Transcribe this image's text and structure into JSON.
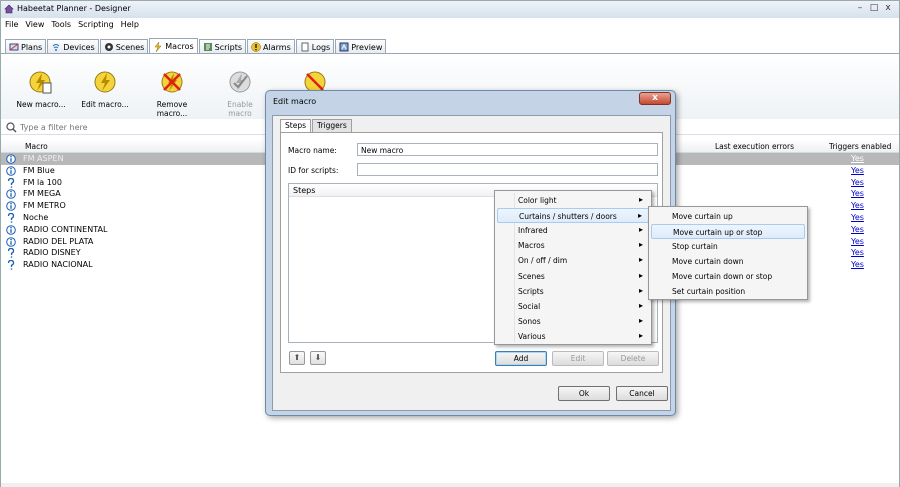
{
  "window": {
    "title": "Habeetat Planner - Designer",
    "controls": [
      "–",
      "□",
      "x"
    ]
  },
  "menubar": [
    "File",
    "View",
    "Tools",
    "Scripting",
    "Help"
  ],
  "tabs": [
    {
      "label": "Plans",
      "icon": "plans-icon"
    },
    {
      "label": "Devices",
      "icon": "devices-icon"
    },
    {
      "label": "Scenes",
      "icon": "scenes-icon"
    },
    {
      "label": "Macros",
      "icon": "macros-icon",
      "active": true
    },
    {
      "label": "Scripts",
      "icon": "scripts-icon"
    },
    {
      "label": "Alarms",
      "icon": "alarms-icon"
    },
    {
      "label": "Logs",
      "icon": "logs-icon"
    },
    {
      "label": "Preview",
      "icon": "preview-icon"
    }
  ],
  "toolbar": {
    "new": "New macro...",
    "edit": "Edit macro...",
    "remove": "Remove macro...",
    "enable": "Enable macro"
  },
  "filter": {
    "placeholder": "Type a filter here"
  },
  "grid": {
    "columns": {
      "macro": "Macro",
      "errors": "Last execution errors",
      "triggers": "Triggers enabled"
    },
    "rows": [
      {
        "name": "FM ASPEN",
        "triggers": "Yes",
        "icon": "info-icon",
        "selected": true
      },
      {
        "name": "FM Blue",
        "triggers": "Yes",
        "icon": "info-icon"
      },
      {
        "name": "FM la 100",
        "triggers": "Yes",
        "icon": "question-icon"
      },
      {
        "name": "FM MEGA",
        "triggers": "Yes",
        "icon": "info-icon"
      },
      {
        "name": "FM METRO",
        "triggers": "Yes",
        "icon": "info-icon"
      },
      {
        "name": "Noche",
        "triggers": "Yes",
        "icon": "question-icon"
      },
      {
        "name": "RADIO CONTINENTAL",
        "triggers": "Yes",
        "icon": "info-icon"
      },
      {
        "name": "RADIO DEL PLATA",
        "triggers": "Yes",
        "icon": "info-icon"
      },
      {
        "name": "RADIO DISNEY",
        "triggers": "Yes",
        "icon": "question-icon"
      },
      {
        "name": "RADIO NACIONAL",
        "triggers": "Yes",
        "icon": "question-icon"
      }
    ]
  },
  "dialog": {
    "title": "Edit macro",
    "close": "x",
    "tabs": [
      "Steps",
      "Triggers"
    ],
    "macro_name_label": "Macro name:",
    "macro_name_value": "New macro",
    "id_label": "ID for scripts:",
    "id_value": "",
    "steps_header": "Steps",
    "add": "Add",
    "edit": "Edit",
    "delete": "Delete",
    "ok": "Ok",
    "cancel": "Cancel",
    "up": "⬆",
    "down": "⬇"
  },
  "context_menu": [
    {
      "label": "Color light",
      "arrow": "▸"
    },
    {
      "label": "Curtains / shutters / doors",
      "arrow": "▸",
      "highlighted": true
    },
    {
      "label": "Infrared",
      "arrow": "▸"
    },
    {
      "label": "Macros",
      "arrow": "▸"
    },
    {
      "label": "On / off / dim",
      "arrow": "▸"
    },
    {
      "label": "Scenes",
      "arrow": "▸"
    },
    {
      "label": "Scripts",
      "arrow": "▸"
    },
    {
      "label": "Social",
      "arrow": "▸"
    },
    {
      "label": "Sonos",
      "arrow": "▸"
    },
    {
      "label": "Various",
      "arrow": "▸"
    }
  ],
  "submenu": [
    {
      "label": "Move curtain up"
    },
    {
      "label": "Move curtain up or stop",
      "highlighted": true
    },
    {
      "label": "Stop curtain"
    },
    {
      "label": "Move curtain down"
    },
    {
      "label": "Move curtain down or stop"
    },
    {
      "label": "Set curtain position"
    }
  ]
}
